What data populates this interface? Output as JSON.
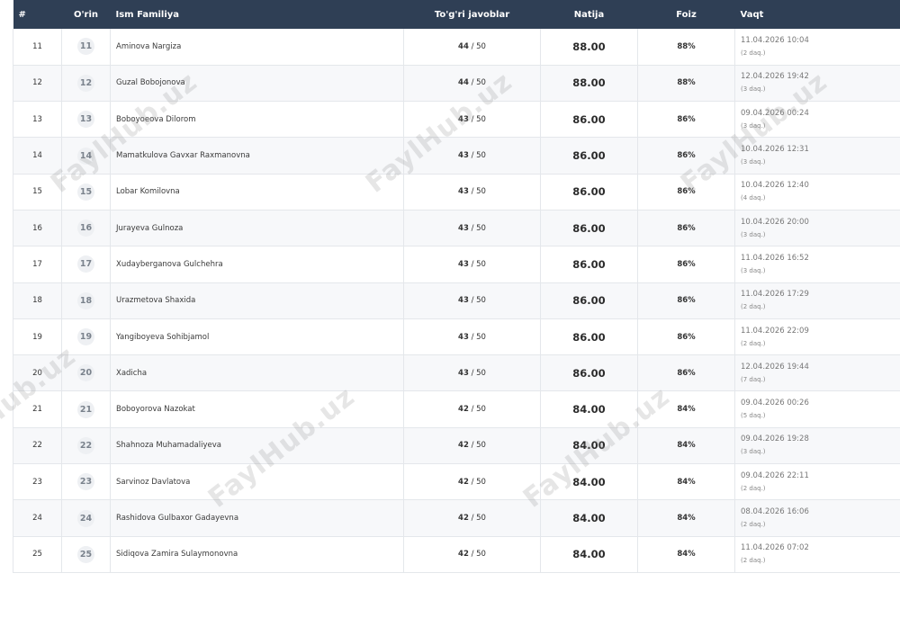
{
  "table": {
    "headers": {
      "num": "#",
      "rank": "O'rin",
      "name": "Ism Familiya",
      "correct": "To'g'ri javoblar",
      "score": "Natija",
      "percent": "Foiz",
      "time": "Vaqt"
    },
    "rows": [
      {
        "num": "11",
        "rank": "11",
        "name": "Aminova Nargiza",
        "correct": "44",
        "total": "/ 50",
        "score": "88.00",
        "percent": "88%",
        "time": "11.04.2026 10:04",
        "duration": "(2 daq.)"
      },
      {
        "num": "12",
        "rank": "12",
        "name": "Guzal Bobojonova",
        "correct": "44",
        "total": "/ 50",
        "score": "88.00",
        "percent": "88%",
        "time": "12.04.2026 19:42",
        "duration": "(3 daq.)"
      },
      {
        "num": "13",
        "rank": "13",
        "name": "Boboyoeova Dilorom",
        "correct": "43",
        "total": "/ 50",
        "score": "86.00",
        "percent": "86%",
        "time": "09.04.2026 00:24",
        "duration": "(3 daq.)"
      },
      {
        "num": "14",
        "rank": "14",
        "name": "Mamatkulova Gavxar Raxmanovna",
        "correct": "43",
        "total": "/ 50",
        "score": "86.00",
        "percent": "86%",
        "time": "10.04.2026 12:31",
        "duration": "(3 daq.)"
      },
      {
        "num": "15",
        "rank": "15",
        "name": "Lobar Komilovna",
        "correct": "43",
        "total": "/ 50",
        "score": "86.00",
        "percent": "86%",
        "time": "10.04.2026 12:40",
        "duration": "(4 daq.)"
      },
      {
        "num": "16",
        "rank": "16",
        "name": "Jurayeva Gulnoza",
        "correct": "43",
        "total": "/ 50",
        "score": "86.00",
        "percent": "86%",
        "time": "10.04.2026 20:00",
        "duration": "(3 daq.)"
      },
      {
        "num": "17",
        "rank": "17",
        "name": "Xudayberganova Gulchehra",
        "correct": "43",
        "total": "/ 50",
        "score": "86.00",
        "percent": "86%",
        "time": "11.04.2026 16:52",
        "duration": "(3 daq.)"
      },
      {
        "num": "18",
        "rank": "18",
        "name": "Urazmetova Shaxida",
        "correct": "43",
        "total": "/ 50",
        "score": "86.00",
        "percent": "86%",
        "time": "11.04.2026 17:29",
        "duration": "(2 daq.)"
      },
      {
        "num": "19",
        "rank": "19",
        "name": "Yangiboyeva Sohibjamol",
        "correct": "43",
        "total": "/ 50",
        "score": "86.00",
        "percent": "86%",
        "time": "11.04.2026 22:09",
        "duration": "(2 daq.)"
      },
      {
        "num": "20",
        "rank": "20",
        "name": "Xadicha",
        "correct": "43",
        "total": "/ 50",
        "score": "86.00",
        "percent": "86%",
        "time": "12.04.2026 19:44",
        "duration": "(7 daq.)"
      },
      {
        "num": "21",
        "rank": "21",
        "name": "Boboyorova Nazokat",
        "correct": "42",
        "total": "/ 50",
        "score": "84.00",
        "percent": "84%",
        "time": "09.04.2026 00:26",
        "duration": "(5 daq.)"
      },
      {
        "num": "22",
        "rank": "22",
        "name": "Shahnoza Muhamadaliyeva",
        "correct": "42",
        "total": "/ 50",
        "score": "84.00",
        "percent": "84%",
        "time": "09.04.2026 19:28",
        "duration": "(3 daq.)"
      },
      {
        "num": "23",
        "rank": "23",
        "name": "Sarvinoz Davlatova",
        "correct": "42",
        "total": "/ 50",
        "score": "84.00",
        "percent": "84%",
        "time": "09.04.2026 22:11",
        "duration": "(2 daq.)"
      },
      {
        "num": "24",
        "rank": "24",
        "name": "Rashidova Gulbaxor Gadayevna",
        "correct": "42",
        "total": "/ 50",
        "score": "84.00",
        "percent": "84%",
        "time": "08.04.2026 16:06",
        "duration": "(2 daq.)"
      },
      {
        "num": "25",
        "rank": "25",
        "name": "Sidiqova Zamira Sulaymonovna",
        "correct": "42",
        "total": "/ 50",
        "score": "84.00",
        "percent": "84%",
        "time": "11.04.2026 07:02",
        "duration": "(2 daq.)"
      }
    ]
  },
  "watermark": "FaylHub.uz"
}
